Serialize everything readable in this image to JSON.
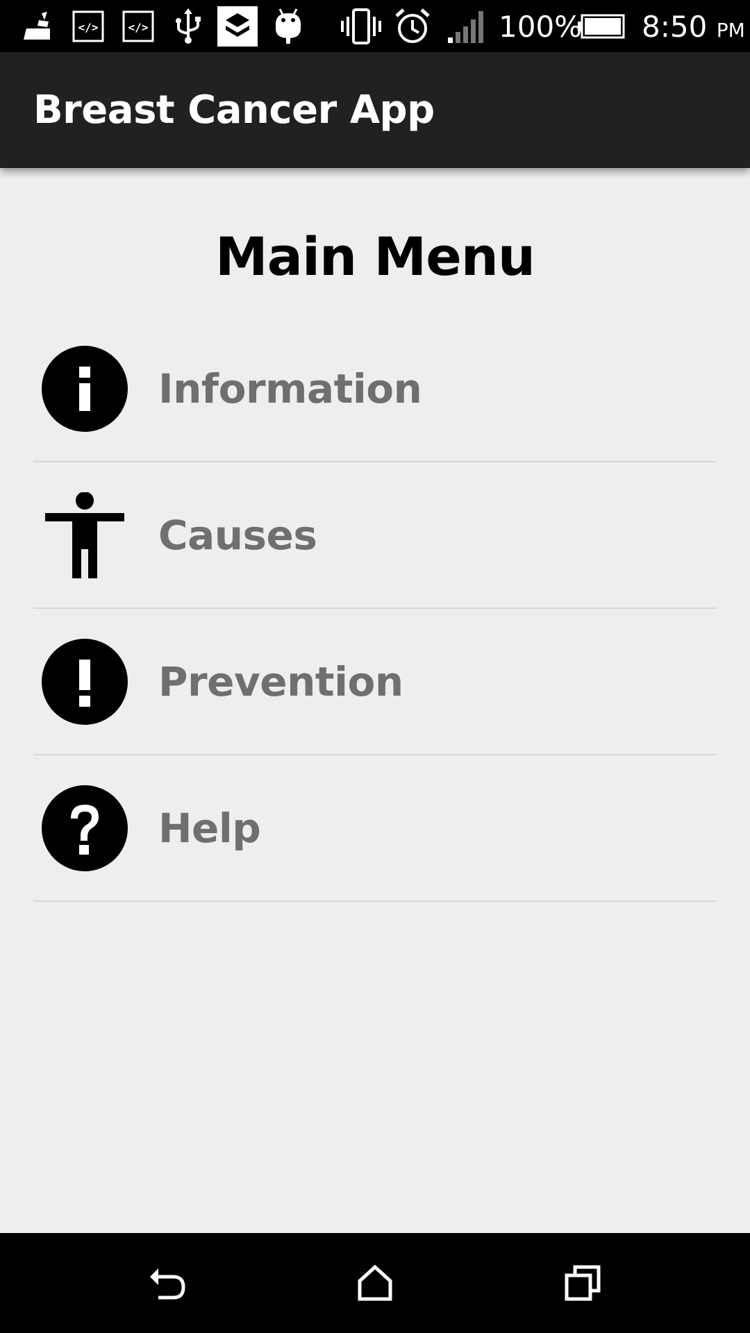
{
  "status_bar": {
    "battery_percent": "100%",
    "time": "8:50",
    "time_suffix": "PM",
    "icons": [
      "cleaner-icon",
      "code-icon",
      "code-icon",
      "usb-icon",
      "app-icon",
      "android-icon",
      "vibrate-icon",
      "alarm-icon",
      "signal-icon",
      "battery-icon"
    ]
  },
  "app_bar": {
    "title": "Breast Cancer App",
    "background": "#212121"
  },
  "main": {
    "title": "Main Menu",
    "menu_items": [
      {
        "label": "Information",
        "icon": "info-icon"
      },
      {
        "label": "Causes",
        "icon": "person-icon"
      },
      {
        "label": "Prevention",
        "icon": "exclamation-icon"
      },
      {
        "label": "Help",
        "icon": "question-icon"
      }
    ]
  },
  "nav_bar": {
    "buttons": [
      "back-icon",
      "home-icon",
      "recents-icon"
    ]
  }
}
